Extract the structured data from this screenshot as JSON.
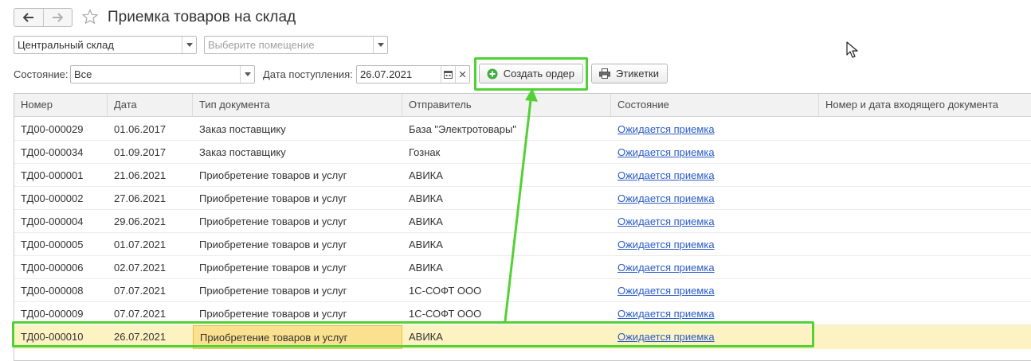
{
  "window": {
    "title": "Приемка товаров на склад",
    "back_icon": "arrow-left-icon",
    "forward_icon": "arrow-right-icon",
    "favorite_icon": "star-outline-icon"
  },
  "filters": {
    "warehouse": {
      "value": "Центральный склад"
    },
    "room": {
      "placeholder": "Выберите помещение"
    },
    "state": {
      "label": "Состояние:",
      "value": "Все"
    },
    "date": {
      "label": "Дата поступления:",
      "value": "26.07.2021"
    }
  },
  "toolbar": {
    "create_order_label": "Создать ордер",
    "labels_label": "Этикетки"
  },
  "colors": {
    "highlight": "#52d134",
    "link": "#2a5bc7",
    "selected_row": "#fdf3c2"
  },
  "table": {
    "columns": [
      "Номер",
      "Дата",
      "Тип документа",
      "Отправитель",
      "Состояние",
      "Номер и дата входящего документа"
    ],
    "rows": [
      {
        "number": "ТД00-000029",
        "date": "01.06.2017",
        "type": "Заказ поставщику",
        "sender": "База \"Электротовары\"",
        "state": "Ожидается приемка",
        "incoming": ""
      },
      {
        "number": "ТД00-000034",
        "date": "01.09.2017",
        "type": "Заказ поставщику",
        "sender": "Гознак",
        "state": "Ожидается приемка",
        "incoming": ""
      },
      {
        "number": "ТД00-000001",
        "date": "21.06.2021",
        "type": "Приобретение товаров и услуг",
        "sender": "АВИКА",
        "state": "Ожидается приемка",
        "incoming": ""
      },
      {
        "number": "ТД00-000002",
        "date": "27.06.2021",
        "type": "Приобретение товаров и услуг",
        "sender": "АВИКА",
        "state": "Ожидается приемка",
        "incoming": ""
      },
      {
        "number": "ТД00-000004",
        "date": "29.06.2021",
        "type": "Приобретение товаров и услуг",
        "sender": "АВИКА",
        "state": "Ожидается приемка",
        "incoming": ""
      },
      {
        "number": "ТД00-000005",
        "date": "01.07.2021",
        "type": "Приобретение товаров и услуг",
        "sender": "АВИКА",
        "state": "Ожидается приемка",
        "incoming": ""
      },
      {
        "number": "ТД00-000006",
        "date": "02.07.2021",
        "type": "Приобретение товаров и услуг",
        "sender": "АВИКА",
        "state": "Ожидается приемка",
        "incoming": ""
      },
      {
        "number": "ТД00-000008",
        "date": "07.07.2021",
        "type": "Приобретение товаров и услуг",
        "sender": "1С-СОФТ ООО",
        "state": "Ожидается приемка",
        "incoming": ""
      },
      {
        "number": "ТД00-000009",
        "date": "07.07.2021",
        "type": "Приобретение товаров и услуг",
        "sender": "1С-СОФТ ООО",
        "state": "Ожидается приемка",
        "incoming": ""
      },
      {
        "number": "ТД00-000010",
        "date": "26.07.2021",
        "type": "Приобретение товаров и услуг",
        "sender": "АВИКА",
        "state": "Ожидается приемка",
        "incoming": ""
      }
    ],
    "selected_row": 9
  }
}
